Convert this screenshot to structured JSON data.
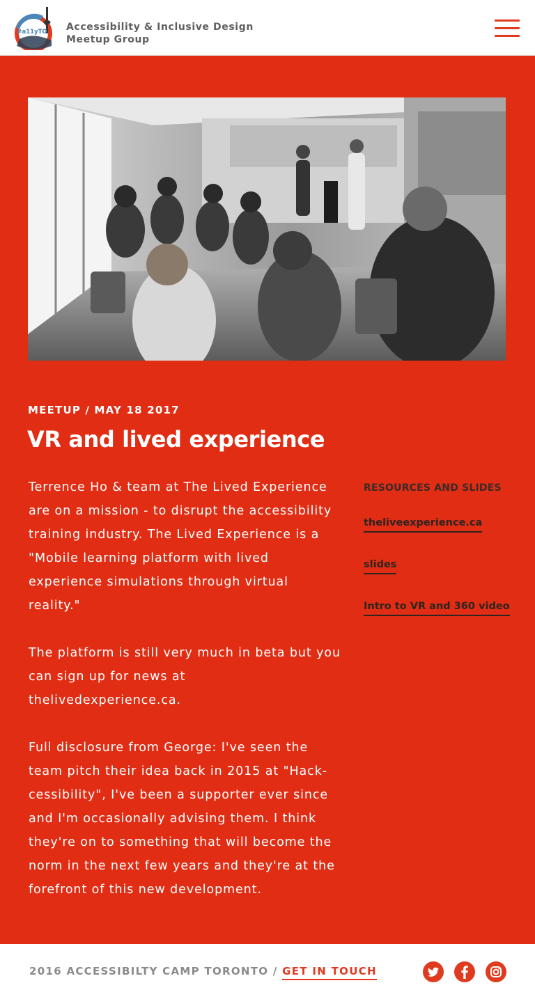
{
  "header": {
    "logo_text": "#a11yTO",
    "title_line1": "Accessibility & Inclusive Design",
    "title_line2": "Meetup Group",
    "menu_icon": "hamburger-icon"
  },
  "post": {
    "photo_icon": "meetup-audience-photo",
    "meta": "MEETUP / MAY 18 2017",
    "title": "VR and lived experience",
    "paragraphs": [
      "Terrence Ho & team at The Lived Experience are on a mission - to disrupt the accessibility training industry. The Lived Experience is a \"Mobile learning platform with lived experience simulations through virtual reality.\"",
      "The platform is still very much in beta but you can sign up for news at thelivedexperience.ca.",
      "Full disclosure from George: I've seen the team pitch their idea back in 2015 at \"Hack-cessibility\", I've been a supporter ever since and I'm occasionally advising them. I think they're on to something that will become the norm in the next few years and they're at the forefront of this new development."
    ]
  },
  "resources": {
    "heading": "RESOURCES AND SLIDES",
    "links": [
      "theliveexperience.ca",
      "slides",
      "Intro to VR and 360 video"
    ]
  },
  "footer": {
    "text": "2016 ACCESSIBILTY CAMP TORONTO / ",
    "link": "GET IN TOUCH",
    "social_icons": [
      "twitter-icon",
      "facebook-icon",
      "instagram-icon"
    ]
  },
  "colors": {
    "accent_red": "#e02d14",
    "dark_text": "#2e2421"
  }
}
